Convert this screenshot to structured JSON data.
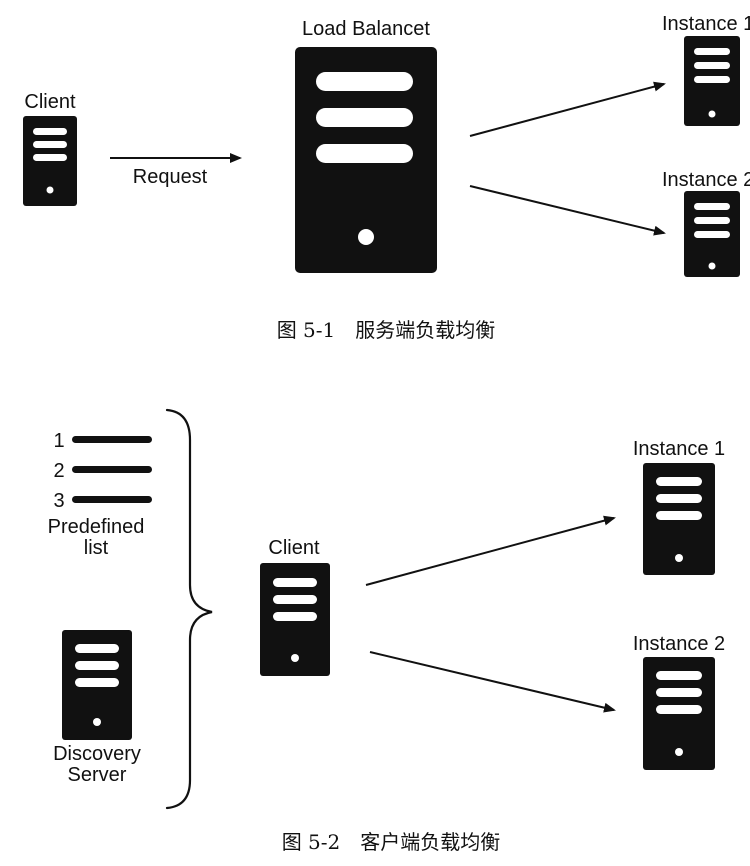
{
  "figure1": {
    "client_label": "Client",
    "request_label": "Request",
    "load_balancer_label": "Load Balancet",
    "instance1_label": "Instance 1",
    "instance2_label": "Instance 2",
    "caption": "图 5-1　服务端负载均衡"
  },
  "figure2": {
    "list_numbers": [
      "1",
      "2",
      "3"
    ],
    "predefined_label_line1": "Predefined",
    "predefined_label_line2": "list",
    "discovery_label_line1": "Discovery",
    "discovery_label_line2": "Server",
    "client_label": "Client",
    "instance1_label": "Instance 1",
    "instance2_label": "Instance 2",
    "caption": "图 5-2　客户端负载均衡"
  },
  "colors": {
    "server": "#111111",
    "slot": "#ffffff",
    "line": "#111111"
  }
}
